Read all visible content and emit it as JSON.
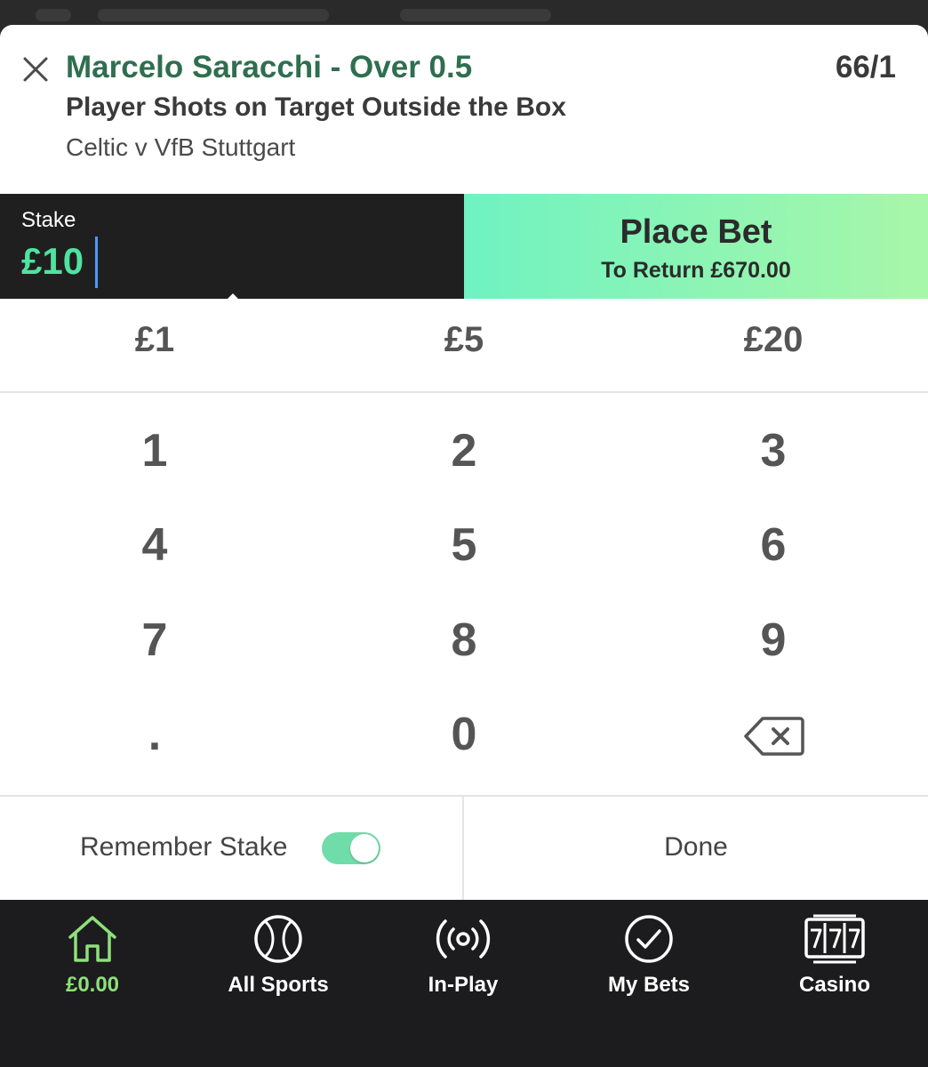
{
  "bet": {
    "selection": "Marcelo Saracchi - Over 0.5",
    "odds": "66/1",
    "market": "Player Shots on Target Outside the Box",
    "event": "Celtic v VfB Stuttgart"
  },
  "stake": {
    "label": "Stake",
    "value": "£10"
  },
  "place_bet": {
    "title": "Place Bet",
    "return_text": "To Return £670.00"
  },
  "quick_stakes": [
    "£1",
    "£5",
    "£20"
  ],
  "keypad": [
    "1",
    "2",
    "3",
    "4",
    "5",
    "6",
    "7",
    "8",
    "9",
    ".",
    "0"
  ],
  "keypad_icons": {
    "backspace": "backspace-icon",
    "close": "close-icon"
  },
  "remember_stake": {
    "label": "Remember Stake",
    "enabled": true
  },
  "done_label": "Done",
  "tabs": [
    {
      "label": "£0.00",
      "icon": "home-icon",
      "active": true
    },
    {
      "label": "All Sports",
      "icon": "ball-icon",
      "active": false
    },
    {
      "label": "In-Play",
      "icon": "broadcast-icon",
      "active": false
    },
    {
      "label": "My Bets",
      "icon": "checkmark-circle-icon",
      "active": false
    },
    {
      "label": "Casino",
      "icon": "slot-machine-icon",
      "active": false
    }
  ],
  "colors": {
    "accent_green": "#4fe3a0",
    "selection_green": "#2f6e4f",
    "active_tab": "#8ee07a",
    "dark_bg": "#1c1c1e"
  }
}
